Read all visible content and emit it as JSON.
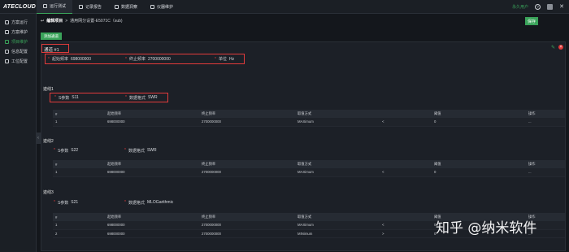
{
  "app": {
    "logo": "ATECLOUD",
    "user": "永久用户"
  },
  "topnav": [
    {
      "label": "运行测试",
      "active": true
    },
    {
      "label": "记录报告",
      "active": false
    },
    {
      "label": "数据洞察",
      "active": false
    },
    {
      "label": "仪器维护",
      "active": false
    }
  ],
  "sidebar": [
    {
      "label": "方案运行",
      "active": false
    },
    {
      "label": "方案维护",
      "active": false
    },
    {
      "label": "项目维护",
      "active": true
    },
    {
      "label": "信息配置",
      "active": false
    },
    {
      "label": "工位配置",
      "active": false
    }
  ],
  "breadcrumb": {
    "current": "编辑项目",
    "sep": ">",
    "path": "通用网分设置-E5071C（sub)"
  },
  "buttons": {
    "save": "保存",
    "add_channel": "添加通道"
  },
  "channel": {
    "title": "通道 #1",
    "start_freq_label": "起始频率",
    "start_freq": "698000000",
    "stop_freq_label": "终止频率",
    "stop_freq": "2700000000",
    "unit_label": "单位",
    "unit": "Hz"
  },
  "labels": {
    "s_param": "S参数",
    "data_format": "数据格式"
  },
  "table_headers": [
    "#",
    "起始频率",
    "终止频率",
    "取值方式",
    "",
    "阈值",
    "操作"
  ],
  "traces": [
    {
      "title": "迹线1",
      "s_param": "S11",
      "format": "SWR",
      "rows": [
        [
          "1",
          "698000000",
          "2700000000",
          "MAXimum",
          "<",
          "0",
          "..."
        ]
      ]
    },
    {
      "title": "迹线2",
      "s_param": "S22",
      "format": "SWR",
      "rows": [
        [
          "1",
          "698000000",
          "2700000000",
          "MAXimum",
          "<",
          "0",
          "..."
        ]
      ]
    },
    {
      "title": "迹线3",
      "s_param": "S21",
      "format": "MLOGarithmic",
      "rows": [
        [
          "1",
          "698000000",
          "2700000000",
          "MAXimum",
          "<",
          "0",
          "..."
        ],
        [
          "2",
          "698000000",
          "2700000000",
          "MINimum",
          ">",
          "0",
          "..."
        ]
      ]
    }
  ],
  "watermark": "知乎 @纳米软件"
}
